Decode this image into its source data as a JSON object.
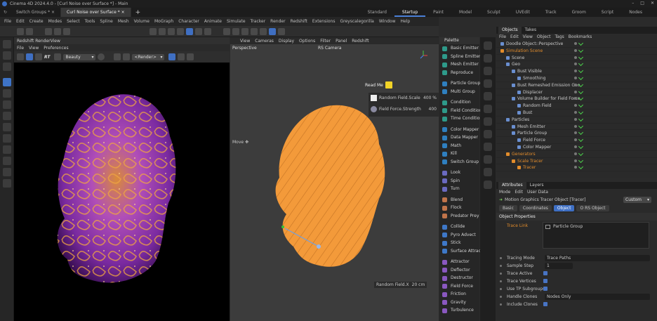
{
  "window": {
    "title": "Cinema 4D 2024.4.0 - [Curl Noise over Surface *] - Main"
  },
  "doc_tabs": [
    {
      "label": "Switch Groups *",
      "active": false
    },
    {
      "label": "Curl Noise over Surface *",
      "active": true
    }
  ],
  "layouts": [
    {
      "label": "Standard",
      "active": false
    },
    {
      "label": "Startup",
      "active": true
    },
    {
      "label": "Paint",
      "active": false
    },
    {
      "label": "Model",
      "active": false
    },
    {
      "label": "Sculpt",
      "active": false
    },
    {
      "label": "UVEdit",
      "active": false
    },
    {
      "label": "Track",
      "active": false
    },
    {
      "label": "Groom",
      "active": false
    },
    {
      "label": "Script",
      "active": false
    },
    {
      "label": "Nodes",
      "active": false
    }
  ],
  "main_menu": [
    "File",
    "Edit",
    "Create",
    "Modes",
    "Select",
    "Tools",
    "Spline",
    "Mesh",
    "Volume",
    "MoGraph",
    "Character",
    "Animate",
    "Simulate",
    "Tracker",
    "Render",
    "Redshift",
    "Extensions",
    "Greyscalegorilla",
    "Window",
    "Help"
  ],
  "renderview": {
    "title": "Redshift RenderView",
    "menu": [
      "File",
      "View",
      "Preferences"
    ],
    "rt_label": "RT",
    "aov_dropdown": "Beauty",
    "render_dropdown": "<Render>"
  },
  "viewport": {
    "menu": [
      "View",
      "Cameras",
      "Display",
      "Options",
      "Filter",
      "Panel",
      "Redshift"
    ],
    "camera_name": "Perspective",
    "camera_mode": "RS Camera",
    "readme_label": "Read Me",
    "hud": [
      {
        "label": "Random Field.Scale",
        "value": "400 %"
      },
      {
        "label": "Field Force.Strength",
        "value": "400"
      }
    ],
    "move_label": "Move",
    "bottom_hud": {
      "label": "Random Field.X",
      "value": "20 cm"
    }
  },
  "palette": {
    "title": "Palette",
    "groups": [
      [
        "Basic Emitter",
        "Spline Emitter",
        "Mesh Emitter",
        "Reproduce"
      ],
      [
        "Particle Group",
        "Multi Group"
      ],
      [
        "Condition",
        "Field Condition",
        "Time Condition"
      ],
      [
        "Color Mapper",
        "Data Mapper",
        "Math",
        "Kill",
        "Switch Group"
      ],
      [
        "Look",
        "Spin",
        "Turn"
      ],
      [
        "Blend",
        "Flock",
        "Predator Prey"
      ],
      [
        "Collide",
        "Pyro Advect",
        "Stick",
        "Surface Attract"
      ],
      [
        "Attractor",
        "Deflector",
        "Destructor",
        "Field Force",
        "Friction",
        "Gravity",
        "Turbulence"
      ]
    ]
  },
  "objects": {
    "tabs": [
      {
        "label": "Objects",
        "active": true
      },
      {
        "label": "Takes",
        "active": false
      }
    ],
    "menu": [
      "File",
      "Edit",
      "View",
      "Object",
      "Tags",
      "Bookmarks"
    ],
    "rows": [
      {
        "name": "Doodle Object::Perspective",
        "depth": 0,
        "color": "#c8c8c8"
      },
      {
        "name": "Simulation Scene",
        "depth": 0,
        "color": "#e28c2b"
      },
      {
        "name": "Scene",
        "depth": 1,
        "color": "#c8c8c8"
      },
      {
        "name": "Geo",
        "depth": 1,
        "color": "#c8c8c8"
      },
      {
        "name": "Bust Visible",
        "depth": 2,
        "color": "#c8c8c8"
      },
      {
        "name": "Smoothing",
        "depth": 3,
        "color": "#c8c8c8"
      },
      {
        "name": "Bust Remeshed Emission Geo",
        "depth": 2,
        "color": "#c8c8c8"
      },
      {
        "name": "Displacer",
        "depth": 3,
        "color": "#c8c8c8"
      },
      {
        "name": "Volume Builder for Field Force",
        "depth": 2,
        "color": "#c8c8c8"
      },
      {
        "name": "Random Field",
        "depth": 3,
        "color": "#c8c8c8"
      },
      {
        "name": "Bust",
        "depth": 3,
        "color": "#c8c8c8"
      },
      {
        "name": "Particles",
        "depth": 1,
        "color": "#c8c8c8"
      },
      {
        "name": "Mesh Emitter",
        "depth": 2,
        "color": "#c8c8c8"
      },
      {
        "name": "Particle Group",
        "depth": 2,
        "color": "#c8c8c8"
      },
      {
        "name": "Field Force",
        "depth": 3,
        "color": "#c8c8c8"
      },
      {
        "name": "Color Mapper",
        "depth": 3,
        "color": "#c8c8c8"
      },
      {
        "name": "Generators",
        "depth": 1,
        "color": "#e28c2b"
      },
      {
        "name": "Scale Tracer",
        "depth": 2,
        "color": "#e28c2b"
      },
      {
        "name": "Tracer",
        "depth": 3,
        "color": "#e28c2b"
      }
    ]
  },
  "attributes": {
    "tabs": [
      {
        "label": "Attributes",
        "active": true
      },
      {
        "label": "Layers",
        "active": false
      }
    ],
    "menu": [
      "Mode",
      "Edit",
      "User Data"
    ],
    "custom_dropdown": "Custom",
    "object_title": "Motion Graphics Tracer Object [Tracer]",
    "buttons": [
      {
        "label": "Basic",
        "active": false
      },
      {
        "label": "Coordinates",
        "active": false
      },
      {
        "label": "Object",
        "active": true
      },
      {
        "label": "O RS Object",
        "active": false
      }
    ],
    "section": "Object Properties",
    "trace_link_label": "Trace Link",
    "trace_link_value": "Particle Group",
    "props": [
      {
        "label": "Tracing Mode",
        "value": "Trace Paths",
        "kind": "dropdown"
      },
      {
        "label": "Sample Step",
        "value": "1",
        "kind": "field"
      },
      {
        "label": "Trace Active",
        "value": "",
        "kind": "check"
      },
      {
        "label": "Trace Vertices",
        "value": "",
        "kind": "check"
      },
      {
        "label": "Use TP Subgroups",
        "value": "",
        "kind": "check"
      },
      {
        "label": "Handle Clones",
        "value": "Nodes Only",
        "kind": "dropdown"
      },
      {
        "label": "Include Clones",
        "value": "",
        "kind": "check"
      }
    ]
  }
}
